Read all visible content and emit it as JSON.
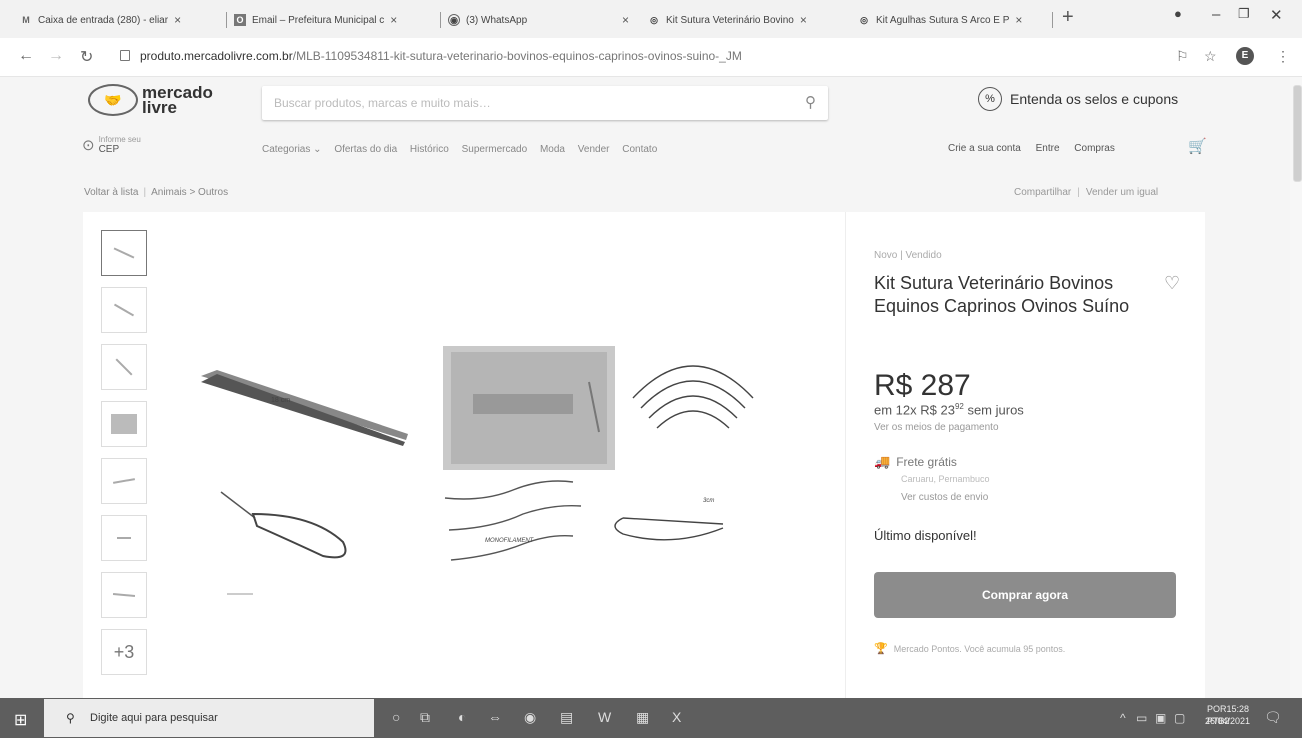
{
  "browser": {
    "tabs": [
      {
        "icon": "gmail-icon",
        "label": "Caixa de entrada (280) - eliar"
      },
      {
        "icon": "outlook-icon",
        "label": "Email – Prefeitura Municipal c"
      },
      {
        "icon": "whatsapp-icon",
        "label": "(3) WhatsApp"
      },
      {
        "icon": "mercadolivre-icon",
        "label": "Kit Sutura Veterinário Bovino"
      },
      {
        "icon": "mercadolivre-icon",
        "label": "Kit Agulhas Sutura S Arco E P"
      }
    ],
    "url_host": "produto.mercadolivre.com.br",
    "url_path": "/MLB-1109534811-kit-sutura-veterinario-bovinos-equinos-caprinos-ovinos-suino-_JM",
    "profile_initial": "E"
  },
  "header": {
    "logo_line1": "mercado",
    "logo_line2": "livre",
    "search_placeholder": "Buscar produtos, marcas e muito mais…",
    "promo": "Entenda os selos e cupons",
    "cep_small": "Informe seu",
    "cep_big": "CEP",
    "nav": [
      "Categorias ⌄",
      "Ofertas do dia",
      "Histórico",
      "Supermercado",
      "Moda",
      "Vender",
      "Contato"
    ],
    "account": [
      "Crie a sua conta",
      "Entre",
      "Compras"
    ]
  },
  "breadcrumb": {
    "back": "Voltar à lista",
    "path": "Animais > Outros",
    "share": "Compartilhar",
    "sell": "Vender um igual"
  },
  "product": {
    "condition": "Novo  |  Vendido",
    "title": "Kit Sutura Veterinário Bovinos Equinos Caprinos Ovinos Suíno",
    "price": "R$ 287",
    "installments_pre": "em 12x R$ 23",
    "installments_cents": "92",
    "installments_post": " sem juros",
    "payment_link": "Ver os meios de pagamento",
    "shipping": "Frete grátis",
    "shipping_sub": "Caruaru, Pernambuco",
    "shipping_cost": "Ver custos de envio",
    "stock": "Último disponível!",
    "buy": "Comprar agora",
    "points": "Mercado Pontos. Você acumula 95 pontos.",
    "more_images": "+3",
    "image_labels": {
      "tweezers": "18 cm",
      "needles": "MONOFILAMENT",
      "pin": "3cm"
    }
  },
  "taskbar": {
    "search": "Digite aqui para pesquisar",
    "lang1": "POR",
    "lang2": "PTB2",
    "time": "15:28",
    "date": "26/04/2021"
  }
}
